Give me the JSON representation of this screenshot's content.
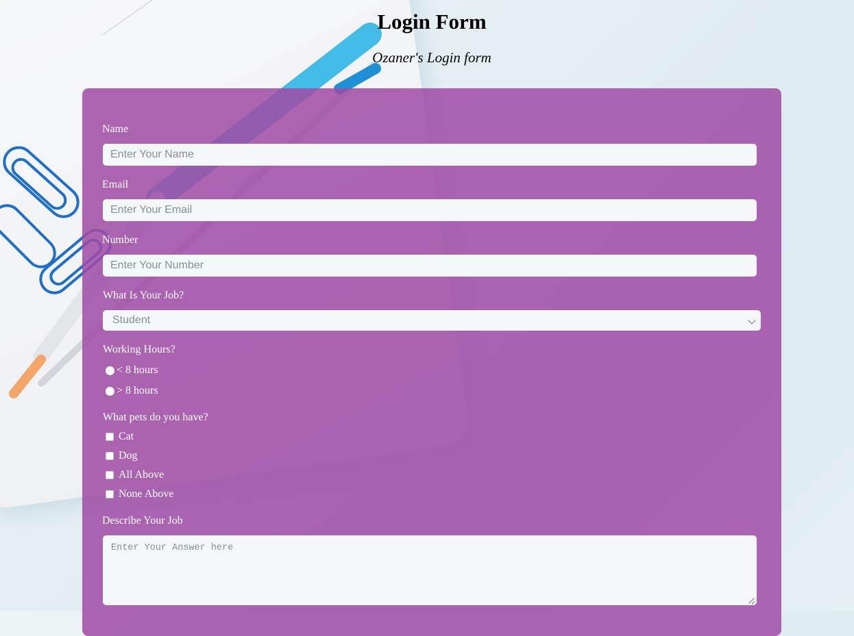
{
  "header": {
    "title": "Login Form",
    "subtitle": "Ozaner's Login form"
  },
  "form": {
    "name": {
      "label": "Name",
      "placeholder": "Enter Your Name"
    },
    "email": {
      "label": "Email",
      "placeholder": "Enter Your Email"
    },
    "number": {
      "label": "Number",
      "placeholder": "Enter Your Number"
    },
    "job": {
      "label": "What Is Your Job?",
      "selected": "Student"
    },
    "working_hours": {
      "label": "Working Hours?",
      "options": [
        "< 8 hours",
        "> 8 hours"
      ]
    },
    "pets": {
      "label": "What pets do you have?",
      "options": [
        "Cat",
        "Dog",
        "All Above",
        "None Above"
      ]
    },
    "describe": {
      "label": "Describe Your Job",
      "placeholder": "Enter Your Answer here"
    }
  },
  "colors": {
    "card": "#a04ca5",
    "input_bg": "#f3f7f8",
    "clip": "#1f6fc7"
  },
  "icons": {
    "select": "chevron-down-icon",
    "textarea": "resize-handle-icon"
  }
}
